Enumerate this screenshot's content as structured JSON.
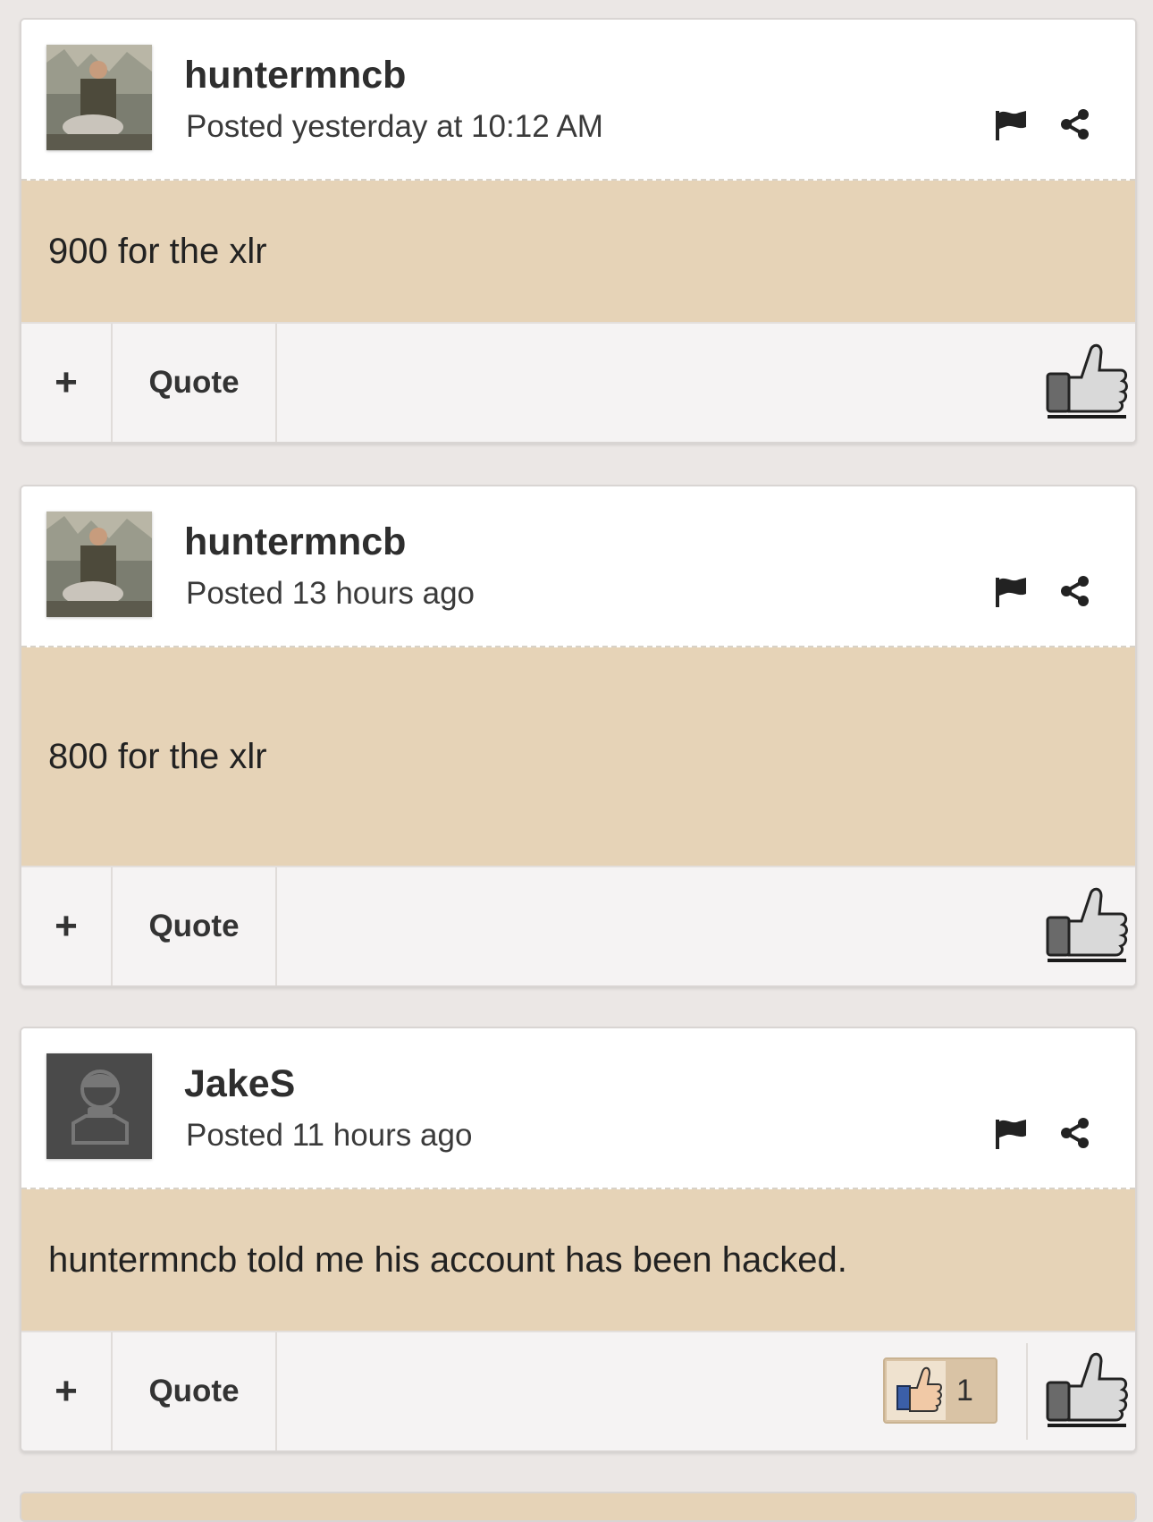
{
  "posts": [
    {
      "author": "huntermncb",
      "meta": "Posted yesterday at 10:12 AM",
      "body": "900 for the xlr",
      "avatar": "hunter-photo",
      "actions": {
        "plus": "+",
        "quote": "Quote"
      },
      "reactions": null
    },
    {
      "author": "huntermncb",
      "meta": "Posted 13 hours ago",
      "body": "800 for the xlr",
      "avatar": "hunter-photo",
      "actions": {
        "plus": "+",
        "quote": "Quote"
      },
      "reactions": null
    },
    {
      "author": "JakeS",
      "meta": "Posted 11 hours ago",
      "body": "huntermncb told me his account has been hacked.",
      "avatar": "default-user-silhouette",
      "actions": {
        "plus": "+",
        "quote": "Quote"
      },
      "reactions": {
        "count": "1",
        "icon": "like-reaction-icon"
      }
    }
  ],
  "colors": {
    "page_bg": "#ebe7e5",
    "body_bg": "#e6d3b7",
    "footer_bg": "#f5f3f3",
    "reaction_bg": "#d9c3a5"
  },
  "icons": [
    "flag-icon",
    "share-icon",
    "thumbs-up-icon"
  ]
}
